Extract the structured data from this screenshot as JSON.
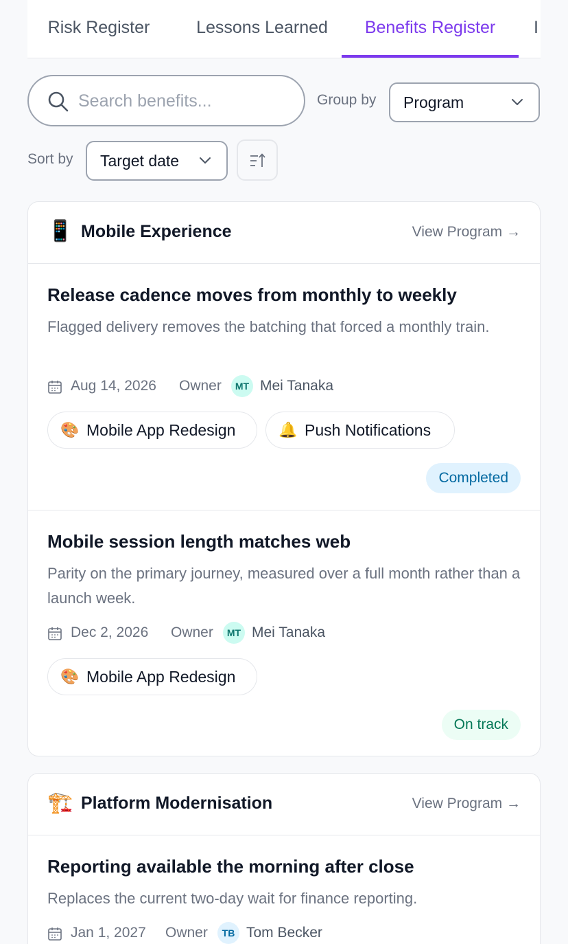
{
  "tabs": [
    {
      "label": "Risk Register",
      "active": false
    },
    {
      "label": "Lessons Learned",
      "active": false
    },
    {
      "label": "Benefits Register",
      "active": true
    },
    {
      "label": "I",
      "active": false
    }
  ],
  "toolbar": {
    "search_placeholder": "Search benefits...",
    "search_value": "",
    "search_icon": "search-icon",
    "group_label": "Group by",
    "group_value": "Program",
    "sort_label": "Sort by",
    "sort_value": "Target date",
    "sort_direction_icon": "sort-ascending-icon"
  },
  "colors": {
    "accent": "#7c3aed",
    "completed_bg": "#e0f2fe",
    "completed_text": "#0369a1",
    "ontrack_bg": "#ecfdf5",
    "ontrack_text": "#047857"
  },
  "programs": [
    {
      "emoji": "📱",
      "name": "Mobile Experience",
      "link": "View Program →",
      "benefits": [
        {
          "title": "Release cadence moves from monthly to weekly",
          "description": "Flagged delivery removes the batching that forced a monthly train.",
          "date": "Aug 14, 2026",
          "owner_label": "Owner",
          "owner_initials": "MT",
          "owner_name": "Mei Tanaka",
          "projects": [
            {
              "emoji": "🎨",
              "name": "Mobile App Redesign"
            },
            {
              "emoji": "🔔",
              "name": "Push Notifications"
            }
          ],
          "status": "Completed"
        },
        {
          "title": "Mobile session length matches web",
          "description": "Parity on the primary journey, measured over a full month rather than a launch week.",
          "date": "Dec 2, 2026",
          "owner_label": "Owner",
          "owner_initials": "MT",
          "owner_name": "Mei Tanaka",
          "projects": [
            {
              "emoji": "🎨",
              "name": "Mobile App Redesign"
            }
          ],
          "status": "On track"
        }
      ]
    },
    {
      "emoji": "🏗️",
      "name": "Platform Modernisation",
      "link": "View Program →",
      "benefits": [
        {
          "title": "Reporting available the morning after close",
          "description": "Replaces the current two-day wait for finance reporting.",
          "date": "Jan 1, 2027",
          "owner_label": "Owner",
          "owner_initials": "TB",
          "owner_name": "Tom Becker"
        }
      ]
    }
  ]
}
